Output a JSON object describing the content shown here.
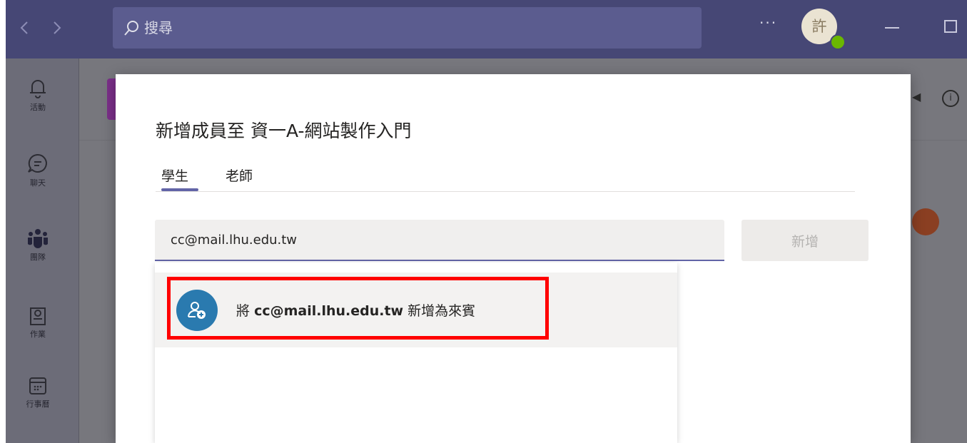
{
  "search": {
    "placeholder": "搜尋"
  },
  "header": {
    "more_label": "···",
    "avatar_initial": "許"
  },
  "rail": {
    "items": [
      {
        "label": "活動",
        "icon": "bell-icon"
      },
      {
        "label": "聊天",
        "icon": "chat-icon"
      },
      {
        "label": "團隊",
        "icon": "teams-icon"
      },
      {
        "label": "作業",
        "icon": "assignments-icon"
      },
      {
        "label": "行事曆",
        "icon": "calendar-icon"
      }
    ]
  },
  "dialog": {
    "title": "新增成員至 資一A-網站製作入門",
    "tabs": [
      {
        "label": "學生",
        "selected": true
      },
      {
        "label": "老師",
        "selected": false
      }
    ],
    "input_value": "cc@mail.lhu.edu.tw",
    "add_button_label": "新增",
    "suggestion": {
      "prefix": "將",
      "email": "cc@mail.lhu.edu.tw",
      "suffix": "新增為來賓"
    }
  },
  "colors": {
    "accent": "#6264a7",
    "titlebar": "#464775",
    "highlight": "#ff0000",
    "guest_avatar": "#2a7aaf"
  }
}
